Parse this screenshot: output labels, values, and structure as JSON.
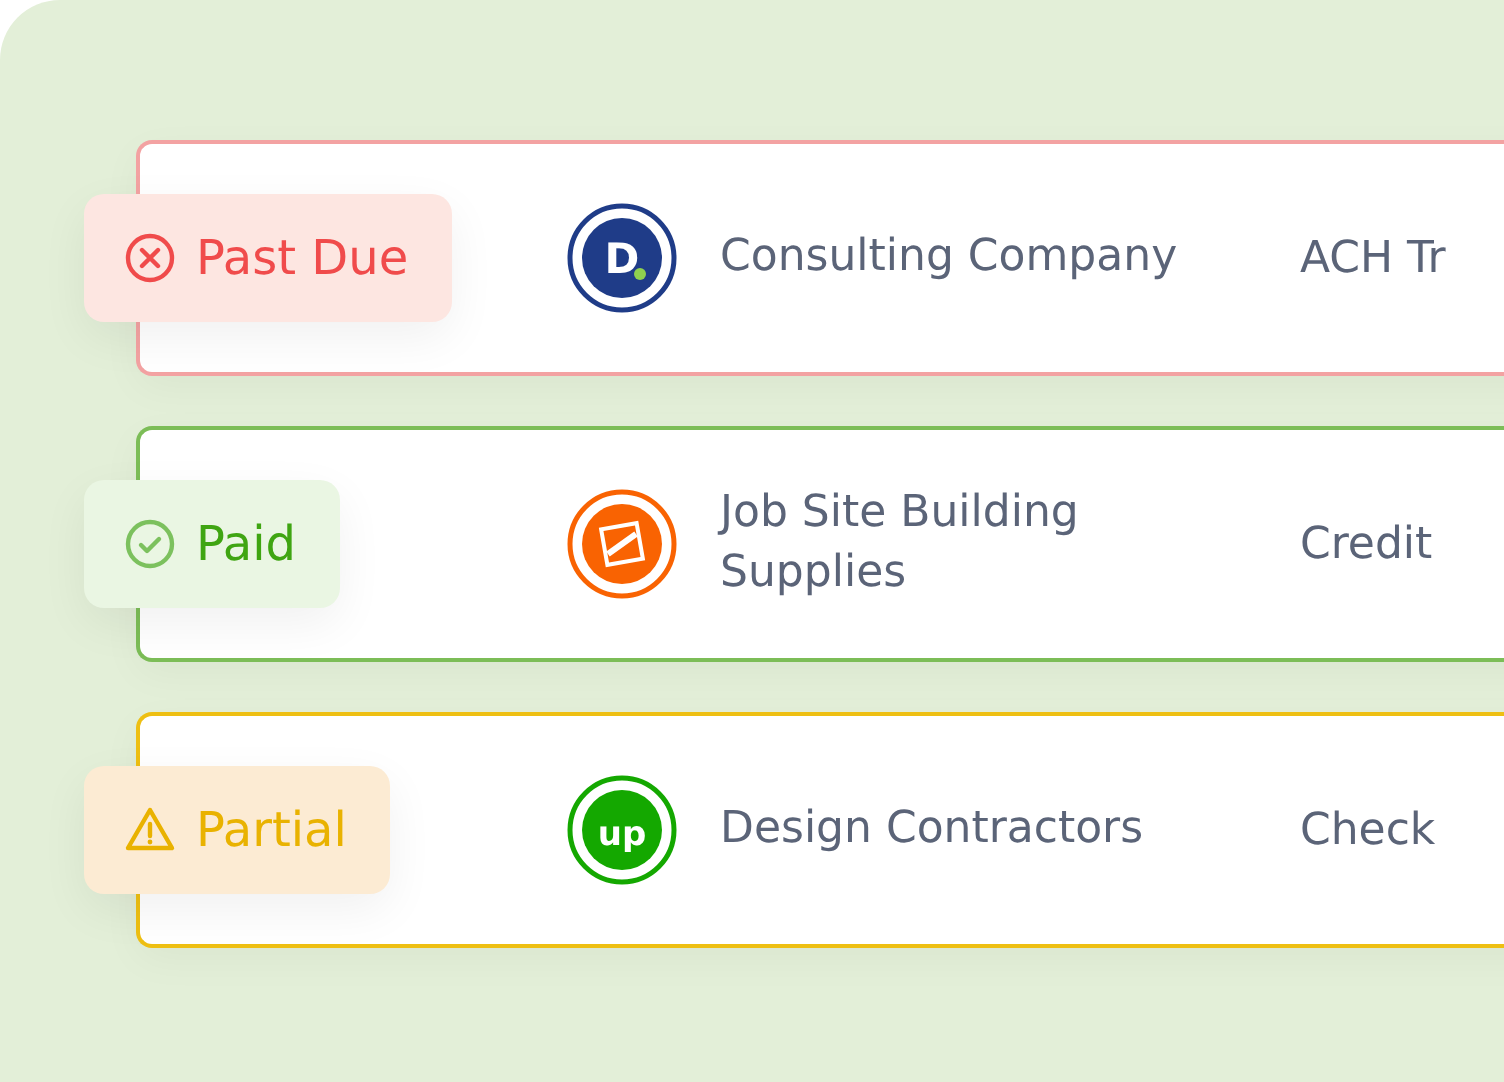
{
  "invoices": [
    {
      "status": {
        "kind": "past_due",
        "label": "Past Due"
      },
      "logo": {
        "kind": "letter_dot",
        "text": "D",
        "color": "#1f3c88"
      },
      "vendor": "Consulting Company",
      "method": "ACH Tr"
    },
    {
      "status": {
        "kind": "paid",
        "label": "Paid"
      },
      "logo": {
        "kind": "square",
        "color": "#f96302"
      },
      "vendor": "Job Site Building Supplies",
      "method": "Credit"
    },
    {
      "status": {
        "kind": "partial",
        "label": "Partial"
      },
      "logo": {
        "kind": "letter",
        "text": "up",
        "color": "#14a800"
      },
      "vendor": "Design Contractors",
      "method": "Check"
    }
  ]
}
